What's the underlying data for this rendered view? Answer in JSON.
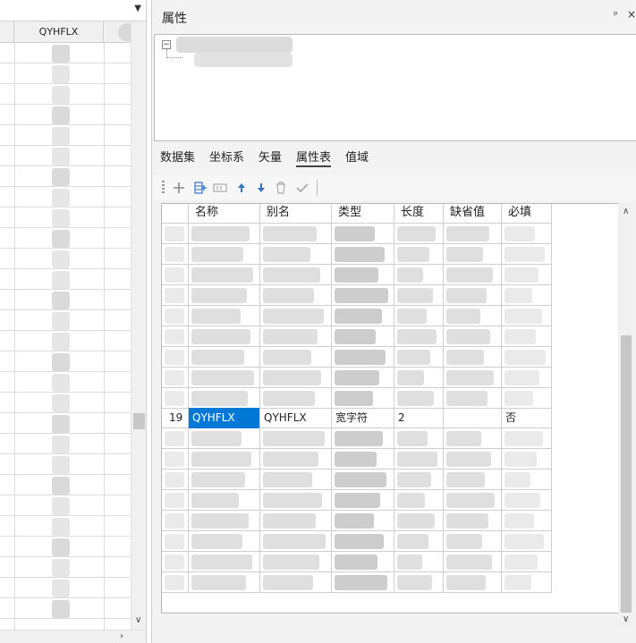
{
  "left_panel": {
    "column_header": "QYHFLX"
  },
  "properties_panel": {
    "title": "属性",
    "pin_glyph": "ᵖ",
    "close_glyph": "×"
  },
  "tree": {
    "expander": "⊟"
  },
  "tabs": [
    {
      "label": "数据集",
      "active": false
    },
    {
      "label": "坐标系",
      "active": false
    },
    {
      "label": "矢量",
      "active": false
    },
    {
      "label": "属性表",
      "active": true
    },
    {
      "label": "值域",
      "active": false
    }
  ],
  "toolbar": {
    "icons": [
      "add-icon",
      "insert-field-icon",
      "rename-field-icon",
      "move-up-icon",
      "move-down-icon",
      "delete-icon",
      "apply-icon"
    ],
    "accent_color": "#2e74c9"
  },
  "attribute_table": {
    "columns": [
      "名称",
      "别名",
      "类型",
      "长度",
      "缺省值",
      "必填"
    ],
    "selected_row": {
      "index": "19",
      "name": "QYHFLX",
      "alias": "QYHFLX",
      "type": "宽字符",
      "length": "2",
      "default": "",
      "required": "否"
    },
    "selection_color": "#0078d7"
  }
}
